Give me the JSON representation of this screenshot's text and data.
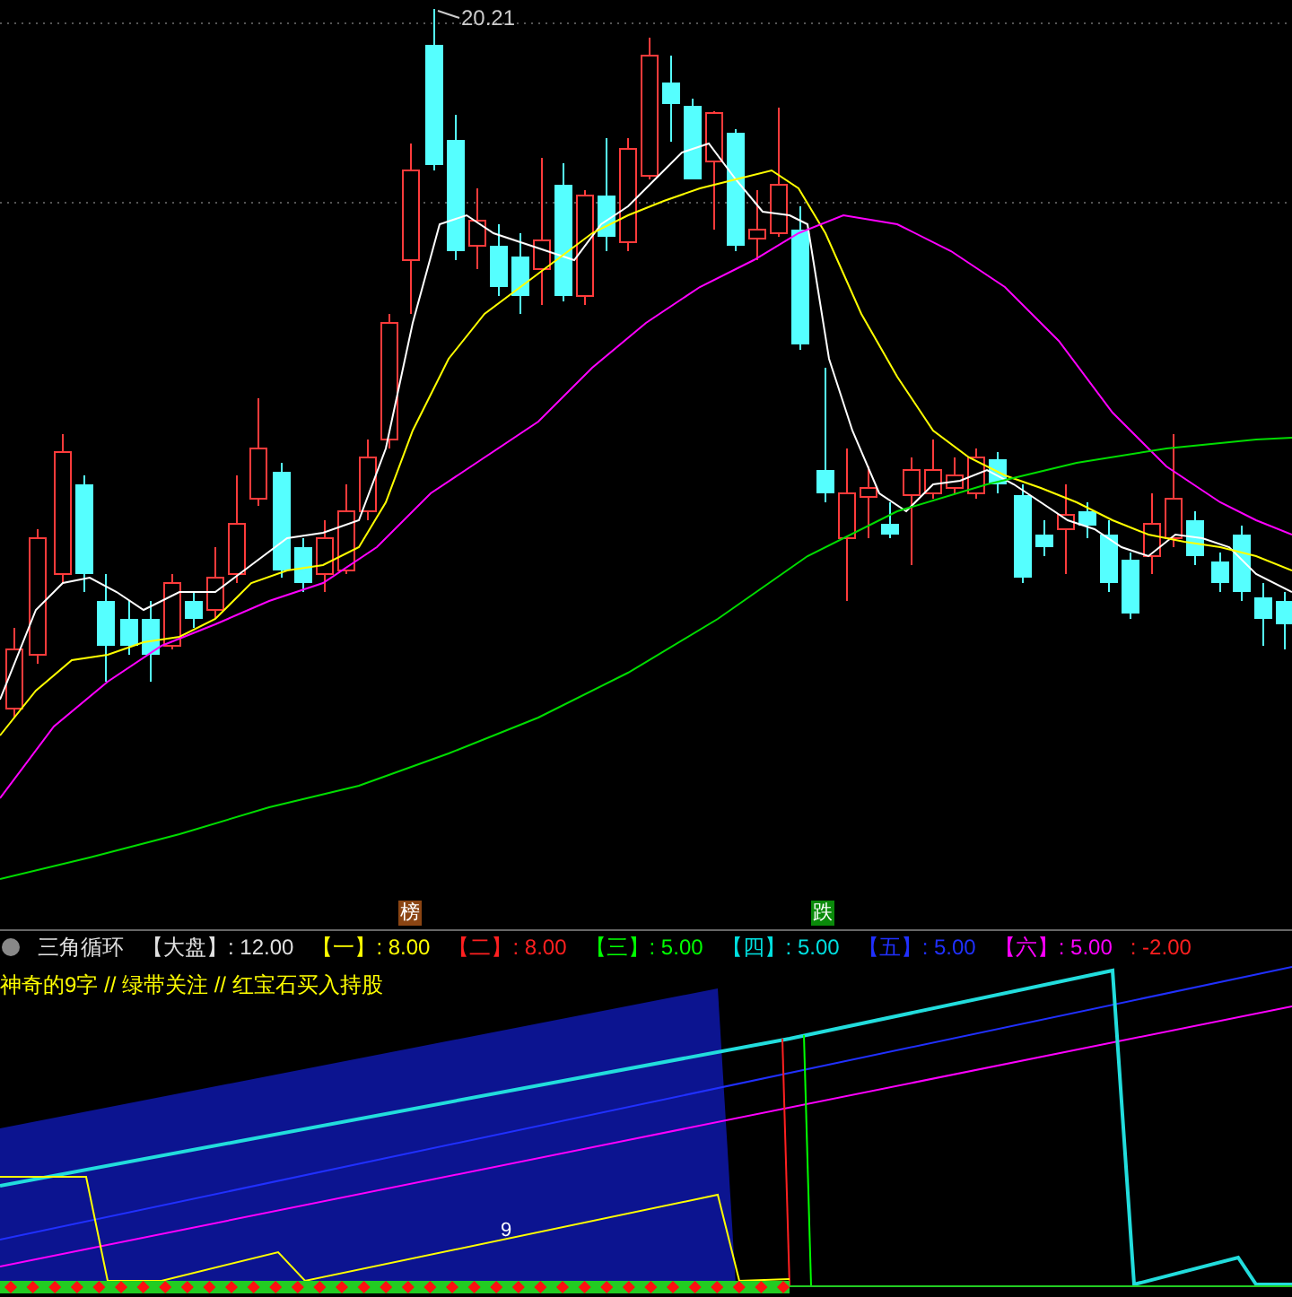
{
  "price_chart": {
    "high_label": "20.21"
  },
  "markers": [
    {
      "text": "榜",
      "kind": "up"
    },
    {
      "text": "跌",
      "kind": "down"
    }
  ],
  "indicator": {
    "name": "三角循环",
    "items": [
      {
        "label": "【大盘】",
        "value": ": 12.00",
        "color": "#e0e0e0"
      },
      {
        "label": "【一】",
        "value": ": 8.00",
        "color": "#ffff00"
      },
      {
        "label": "【二】",
        "value": ": 8.00",
        "color": "#ff2020"
      },
      {
        "label": "【三】",
        "value": ": 5.00",
        "color": "#00ff00"
      },
      {
        "label": "【四】",
        "value": ": 5.00",
        "color": "#00e0e0"
      },
      {
        "label": "【五】",
        "value": ": 5.00",
        "color": "#2030ff"
      },
      {
        "label": "【六】",
        "value": ": 5.00",
        "color": "#ff00ff"
      },
      {
        "value": ": -2.00",
        "color": "#ff2020"
      }
    ],
    "subtitle": "神奇的9字 // 绿带关注 // 红宝石买入持股",
    "chart_label": "9"
  }
}
